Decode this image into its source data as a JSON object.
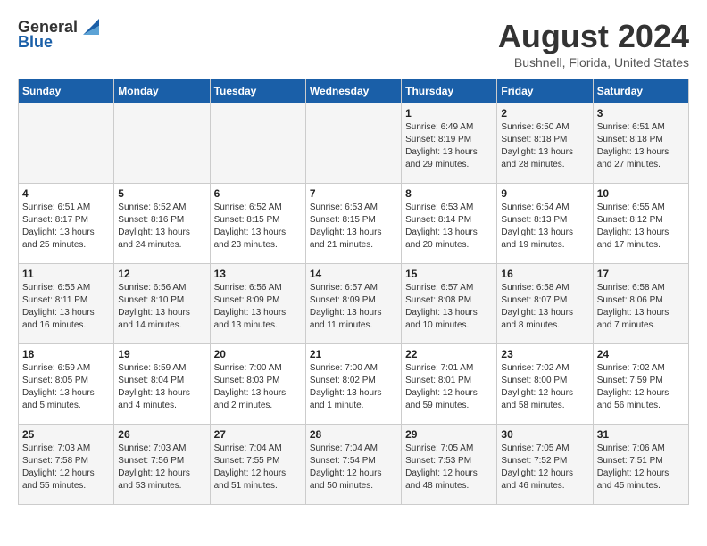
{
  "header": {
    "logo_general": "General",
    "logo_blue": "Blue",
    "month_title": "August 2024",
    "location": "Bushnell, Florida, United States"
  },
  "weekdays": [
    "Sunday",
    "Monday",
    "Tuesday",
    "Wednesday",
    "Thursday",
    "Friday",
    "Saturday"
  ],
  "weeks": [
    [
      {
        "day": "",
        "sunrise": "",
        "sunset": "",
        "daylight": ""
      },
      {
        "day": "",
        "sunrise": "",
        "sunset": "",
        "daylight": ""
      },
      {
        "day": "",
        "sunrise": "",
        "sunset": "",
        "daylight": ""
      },
      {
        "day": "",
        "sunrise": "",
        "sunset": "",
        "daylight": ""
      },
      {
        "day": "1",
        "sunrise": "Sunrise: 6:49 AM",
        "sunset": "Sunset: 8:19 PM",
        "daylight": "Daylight: 13 hours and 29 minutes."
      },
      {
        "day": "2",
        "sunrise": "Sunrise: 6:50 AM",
        "sunset": "Sunset: 8:18 PM",
        "daylight": "Daylight: 13 hours and 28 minutes."
      },
      {
        "day": "3",
        "sunrise": "Sunrise: 6:51 AM",
        "sunset": "Sunset: 8:18 PM",
        "daylight": "Daylight: 13 hours and 27 minutes."
      }
    ],
    [
      {
        "day": "4",
        "sunrise": "Sunrise: 6:51 AM",
        "sunset": "Sunset: 8:17 PM",
        "daylight": "Daylight: 13 hours and 25 minutes."
      },
      {
        "day": "5",
        "sunrise": "Sunrise: 6:52 AM",
        "sunset": "Sunset: 8:16 PM",
        "daylight": "Daylight: 13 hours and 24 minutes."
      },
      {
        "day": "6",
        "sunrise": "Sunrise: 6:52 AM",
        "sunset": "Sunset: 8:15 PM",
        "daylight": "Daylight: 13 hours and 23 minutes."
      },
      {
        "day": "7",
        "sunrise": "Sunrise: 6:53 AM",
        "sunset": "Sunset: 8:15 PM",
        "daylight": "Daylight: 13 hours and 21 minutes."
      },
      {
        "day": "8",
        "sunrise": "Sunrise: 6:53 AM",
        "sunset": "Sunset: 8:14 PM",
        "daylight": "Daylight: 13 hours and 20 minutes."
      },
      {
        "day": "9",
        "sunrise": "Sunrise: 6:54 AM",
        "sunset": "Sunset: 8:13 PM",
        "daylight": "Daylight: 13 hours and 19 minutes."
      },
      {
        "day": "10",
        "sunrise": "Sunrise: 6:55 AM",
        "sunset": "Sunset: 8:12 PM",
        "daylight": "Daylight: 13 hours and 17 minutes."
      }
    ],
    [
      {
        "day": "11",
        "sunrise": "Sunrise: 6:55 AM",
        "sunset": "Sunset: 8:11 PM",
        "daylight": "Daylight: 13 hours and 16 minutes."
      },
      {
        "day": "12",
        "sunrise": "Sunrise: 6:56 AM",
        "sunset": "Sunset: 8:10 PM",
        "daylight": "Daylight: 13 hours and 14 minutes."
      },
      {
        "day": "13",
        "sunrise": "Sunrise: 6:56 AM",
        "sunset": "Sunset: 8:09 PM",
        "daylight": "Daylight: 13 hours and 13 minutes."
      },
      {
        "day": "14",
        "sunrise": "Sunrise: 6:57 AM",
        "sunset": "Sunset: 8:09 PM",
        "daylight": "Daylight: 13 hours and 11 minutes."
      },
      {
        "day": "15",
        "sunrise": "Sunrise: 6:57 AM",
        "sunset": "Sunset: 8:08 PM",
        "daylight": "Daylight: 13 hours and 10 minutes."
      },
      {
        "day": "16",
        "sunrise": "Sunrise: 6:58 AM",
        "sunset": "Sunset: 8:07 PM",
        "daylight": "Daylight: 13 hours and 8 minutes."
      },
      {
        "day": "17",
        "sunrise": "Sunrise: 6:58 AM",
        "sunset": "Sunset: 8:06 PM",
        "daylight": "Daylight: 13 hours and 7 minutes."
      }
    ],
    [
      {
        "day": "18",
        "sunrise": "Sunrise: 6:59 AM",
        "sunset": "Sunset: 8:05 PM",
        "daylight": "Daylight: 13 hours and 5 minutes."
      },
      {
        "day": "19",
        "sunrise": "Sunrise: 6:59 AM",
        "sunset": "Sunset: 8:04 PM",
        "daylight": "Daylight: 13 hours and 4 minutes."
      },
      {
        "day": "20",
        "sunrise": "Sunrise: 7:00 AM",
        "sunset": "Sunset: 8:03 PM",
        "daylight": "Daylight: 13 hours and 2 minutes."
      },
      {
        "day": "21",
        "sunrise": "Sunrise: 7:00 AM",
        "sunset": "Sunset: 8:02 PM",
        "daylight": "Daylight: 13 hours and 1 minute."
      },
      {
        "day": "22",
        "sunrise": "Sunrise: 7:01 AM",
        "sunset": "Sunset: 8:01 PM",
        "daylight": "Daylight: 12 hours and 59 minutes."
      },
      {
        "day": "23",
        "sunrise": "Sunrise: 7:02 AM",
        "sunset": "Sunset: 8:00 PM",
        "daylight": "Daylight: 12 hours and 58 minutes."
      },
      {
        "day": "24",
        "sunrise": "Sunrise: 7:02 AM",
        "sunset": "Sunset: 7:59 PM",
        "daylight": "Daylight: 12 hours and 56 minutes."
      }
    ],
    [
      {
        "day": "25",
        "sunrise": "Sunrise: 7:03 AM",
        "sunset": "Sunset: 7:58 PM",
        "daylight": "Daylight: 12 hours and 55 minutes."
      },
      {
        "day": "26",
        "sunrise": "Sunrise: 7:03 AM",
        "sunset": "Sunset: 7:56 PM",
        "daylight": "Daylight: 12 hours and 53 minutes."
      },
      {
        "day": "27",
        "sunrise": "Sunrise: 7:04 AM",
        "sunset": "Sunset: 7:55 PM",
        "daylight": "Daylight: 12 hours and 51 minutes."
      },
      {
        "day": "28",
        "sunrise": "Sunrise: 7:04 AM",
        "sunset": "Sunset: 7:54 PM",
        "daylight": "Daylight: 12 hours and 50 minutes."
      },
      {
        "day": "29",
        "sunrise": "Sunrise: 7:05 AM",
        "sunset": "Sunset: 7:53 PM",
        "daylight": "Daylight: 12 hours and 48 minutes."
      },
      {
        "day": "30",
        "sunrise": "Sunrise: 7:05 AM",
        "sunset": "Sunset: 7:52 PM",
        "daylight": "Daylight: 12 hours and 46 minutes."
      },
      {
        "day": "31",
        "sunrise": "Sunrise: 7:06 AM",
        "sunset": "Sunset: 7:51 PM",
        "daylight": "Daylight: 12 hours and 45 minutes."
      }
    ]
  ]
}
